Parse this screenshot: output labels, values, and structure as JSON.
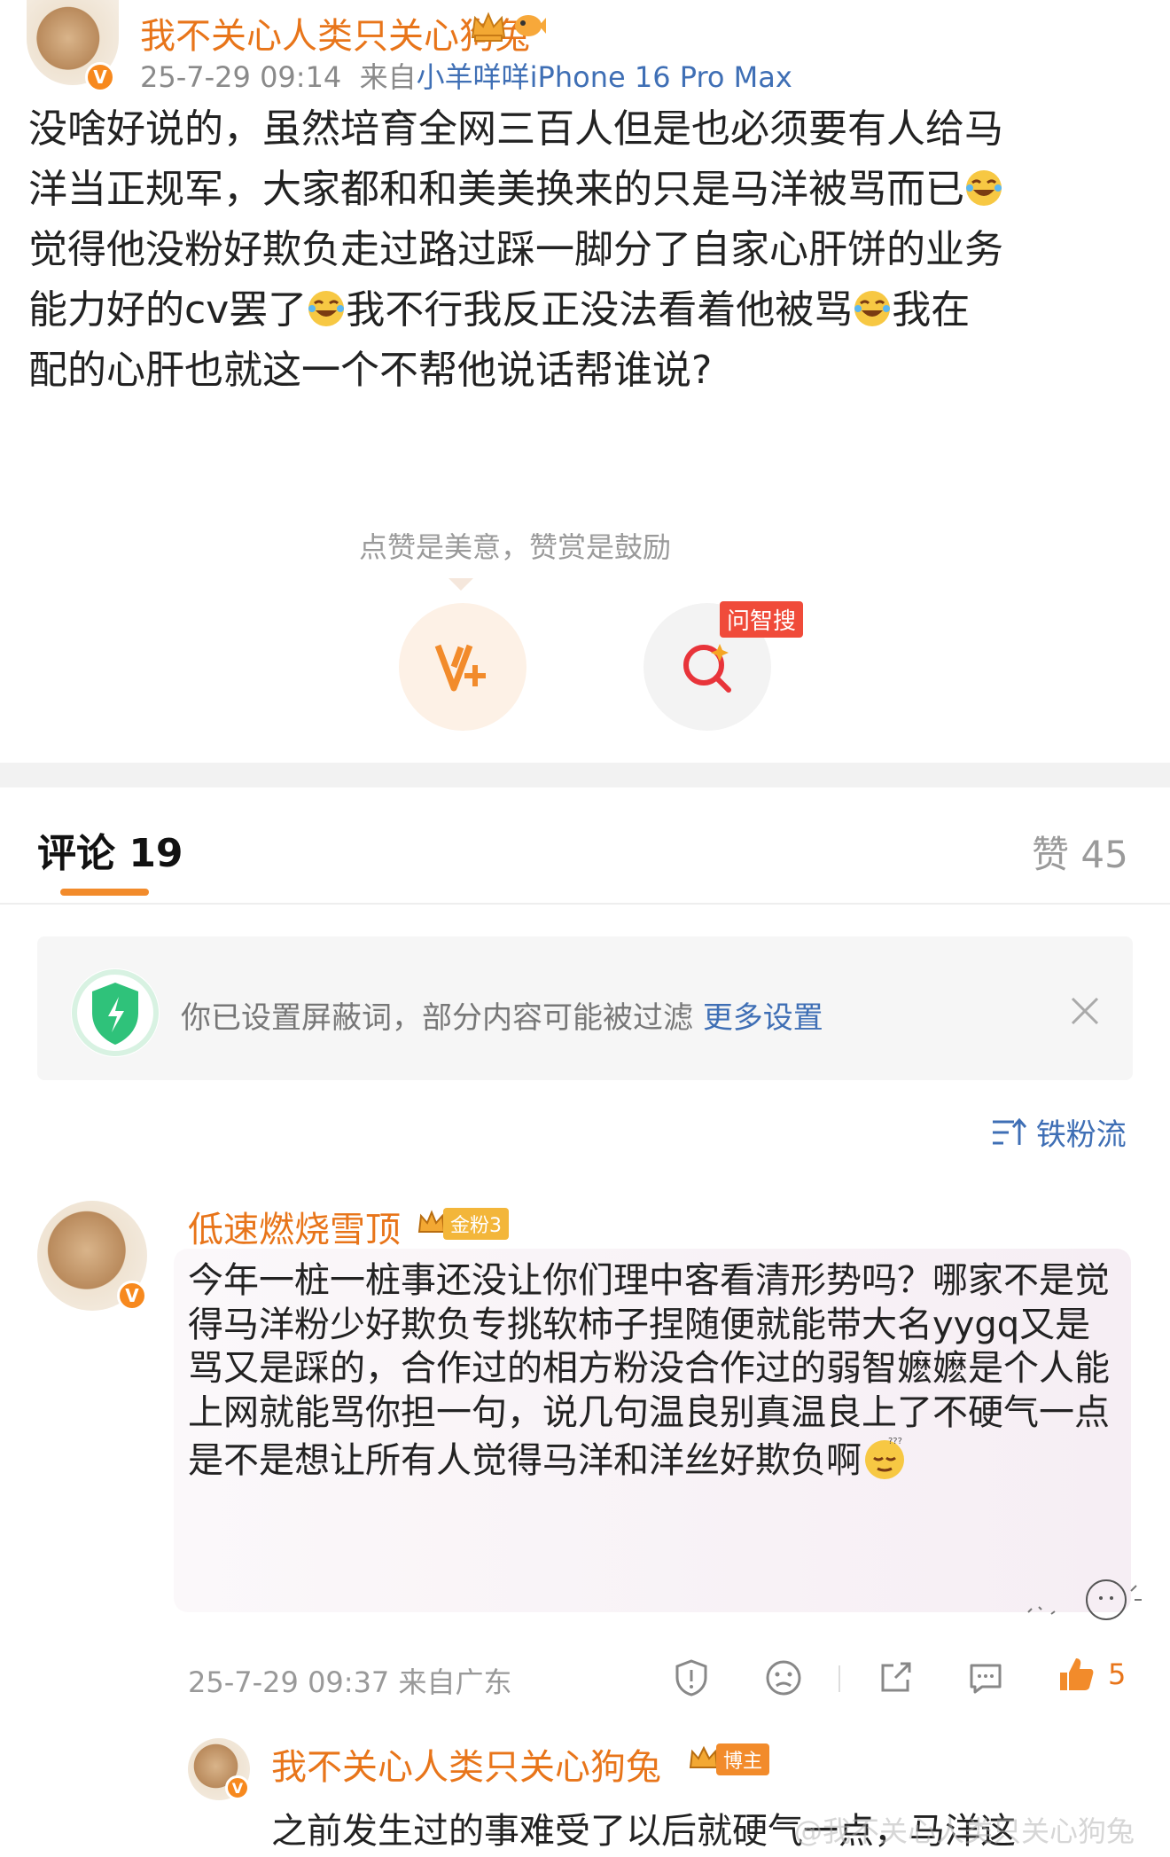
{
  "post": {
    "username": "我不关心人类只关心狗兔",
    "timestamp": "25-7-29 09:14",
    "source_prefix": "来自",
    "source": "小羊咩咩iPhone 16 Pro Max",
    "text_lines": [
      "没啥好说的，虽然培育全网三百人但是也必须要有人给马",
      "洋当正规军，大家都和和美美换来的只是马洋被骂而已",
      "觉得他没粉好欺负走过路过踩一脚分了自家心肝饼的业务",
      "能力好的cv罢了",
      "我不行我反正没法看着他被骂",
      "我在",
      "配的心肝也就这一个不帮他说话帮谁说?"
    ],
    "reward_hint": "点赞是美意，赞赏是鼓励",
    "ask_tag": "问智搜"
  },
  "comments_header": {
    "tab_label": "评论 19",
    "likes_label": "赞 45"
  },
  "notice": {
    "text": "你已设置屏蔽词，部分内容可能被过滤",
    "link": "更多设置"
  },
  "sort_label": "铁粉流",
  "comment": {
    "username": "低速燃烧雪顶",
    "fan_badge": "金粉3",
    "text": "今年一桩一桩事还没让你们理中客看清形势吗？哪家不是觉得马洋粉少好欺负专挑软柿子捏随便就能带大名yygq又是骂又是踩的，合作过的相方粉没合作过的弱智嬷嬷是个人能上网就能骂你担一句，说几句温良别真温良上了不硬气一点是不是想让所有人觉得马洋和洋丝好欺负啊",
    "timestamp": "25-7-29 09:37",
    "location": "来自广东",
    "like_count": "5"
  },
  "reply": {
    "username": "我不关心人类只关心狗兔",
    "badge": "博主",
    "text": "之前发生过的事难受了以后就硬气一点，马洋这"
  },
  "watermark": "@我不关心人类只关心狗兔",
  "colors": {
    "accent_orange": "#e8751a",
    "link_blue": "#3f6fb5",
    "meta_gray": "#8a8a8a"
  }
}
